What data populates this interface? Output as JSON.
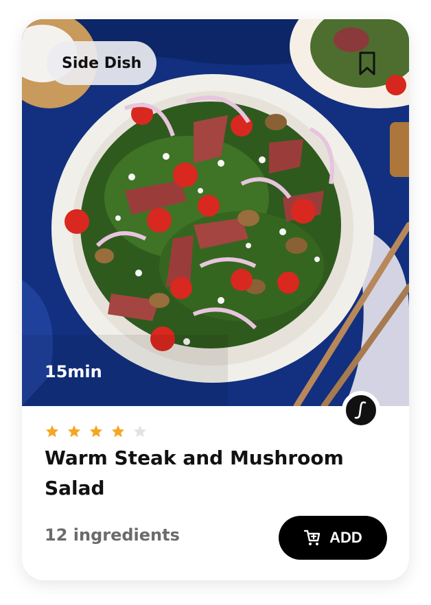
{
  "card": {
    "category_badge": "Side Dish",
    "cook_time": "15min",
    "rating": {
      "value": 4,
      "max": 5,
      "filled_color": "#F5A623",
      "empty_color": "#E3E3E3"
    },
    "title": "Warm Steak and Mushroom Salad",
    "ingredients_count": "12 ingredients",
    "add_button_label": "ADD"
  },
  "icons": {
    "bookmark": "bookmark-icon",
    "brand": "brand-logo-icon",
    "cart_add": "cart-add-icon",
    "star": "star-icon"
  },
  "colors": {
    "accent": "#000000",
    "badge_bg": "#EBEBF0",
    "image_bg": "#0F2A7A"
  }
}
